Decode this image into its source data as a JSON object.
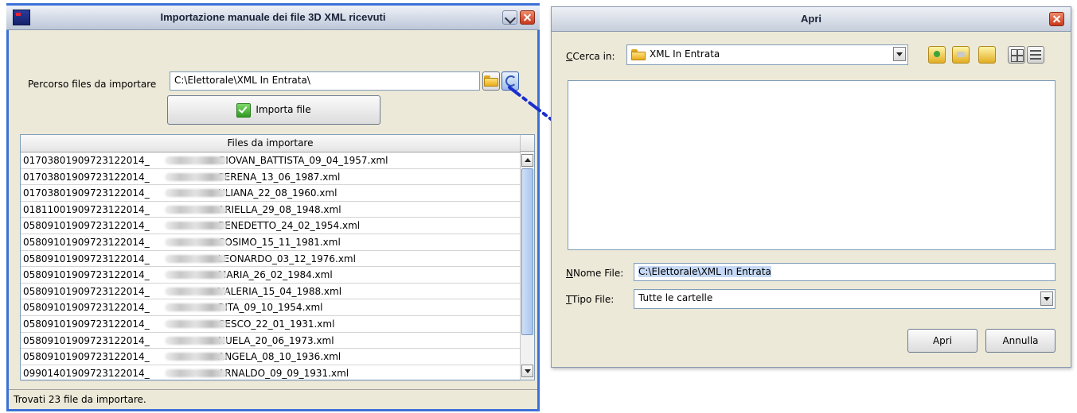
{
  "left_window": {
    "title": "Importazione manuale dei file 3D XML ricevuti",
    "path_label": "Percorso files da importare",
    "path_value": "C:\\Elettorale\\XML In Entrata\\",
    "import_button": "Importa file",
    "table_header": "Files da importare",
    "files": [
      {
        "code": "01703801909723122014_",
        "name": "GIOVAN_BATTISTA_09_04_1957.xml"
      },
      {
        "code": "01703801909723122014_",
        "name": "SERENA_13_06_1987.xml"
      },
      {
        "code": "01703801909723122014_",
        "name": "ULIANA_22_08_1960.xml"
      },
      {
        "code": "01811001909723122014_",
        "name": "ARIELLA_29_08_1948.xml"
      },
      {
        "code": "05809101909723122014_",
        "name": "BENEDETTO_24_02_1954.xml"
      },
      {
        "code": "05809101909723122014_",
        "name": "COSIMO_15_11_1981.xml"
      },
      {
        "code": "05809101909723122014_",
        "name": "LEONARDO_03_12_1976.xml"
      },
      {
        "code": "05809101909723122014_",
        "name": "MARIA_26_02_1984.xml"
      },
      {
        "code": "05809101909723122014_",
        "name": "VALERIA_15_04_1988.xml"
      },
      {
        "code": "05809101909723122014_",
        "name": "RITA_09_10_1954.xml"
      },
      {
        "code": "05809101909723122014_",
        "name": "CESCO_22_01_1931.xml"
      },
      {
        "code": "05809101909723122014_",
        "name": "NUELA_20_06_1973.xml"
      },
      {
        "code": "05809101909723122014_",
        "name": "ANGELA_08_10_1936.xml"
      },
      {
        "code": "09901401909723122014_",
        "name": "ARNALDO_09_09_1931.xml"
      }
    ],
    "status": "Trovati 23 file da importare."
  },
  "right_window": {
    "title": "Apri",
    "lookin_label": "Cerca in:",
    "lookin_value": "XML In Entrata",
    "filename_label": "Nome File:",
    "filename_value": "C:\\Elettorale\\XML In Entrata",
    "filetype_label": "Tipo File:",
    "filetype_value": "Tutte le cartelle",
    "open_button": "Apri",
    "cancel_button": "Annulla"
  },
  "annotation_arrow_color": "#1a2fd0"
}
